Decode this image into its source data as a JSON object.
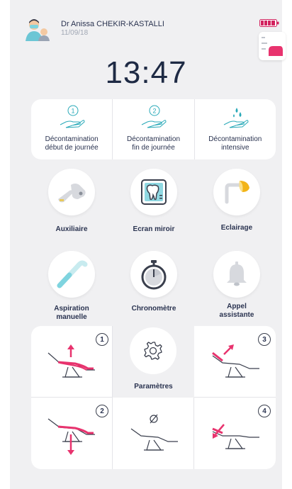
{
  "user": {
    "name": "Dr Anissa CHEKIR-KASTALLI",
    "date": "11/09/18"
  },
  "clock": {
    "time": "13:47"
  },
  "decontamination": [
    {
      "label": "Décontamination\ndébut de journée",
      "icon": "hand-drop-1-icon",
      "step": "1"
    },
    {
      "label": "Décontamination\nfin de journée",
      "icon": "hand-drop-2-icon",
      "step": "2"
    },
    {
      "label": "Décontamination\nintensive",
      "icon": "hand-drops-icon"
    }
  ],
  "controls": {
    "auxiliaire": "Auxiliaire",
    "ecran_miroir": "Ecran miroir",
    "eclairage": "Eclairage",
    "aspiration": "Aspiration\nmanuelle",
    "chronometre": "Chronomètre",
    "appel": "Appel\nassistante"
  },
  "positions": {
    "p1": "1",
    "p2": "2",
    "p3": "3",
    "p4": "4",
    "parametres": "Paramètres"
  },
  "colors": {
    "accent": "#e8336e",
    "text": "#1e2a44",
    "teal": "#28a9b8",
    "battery": "#d2225e",
    "light": "#f2b418"
  }
}
